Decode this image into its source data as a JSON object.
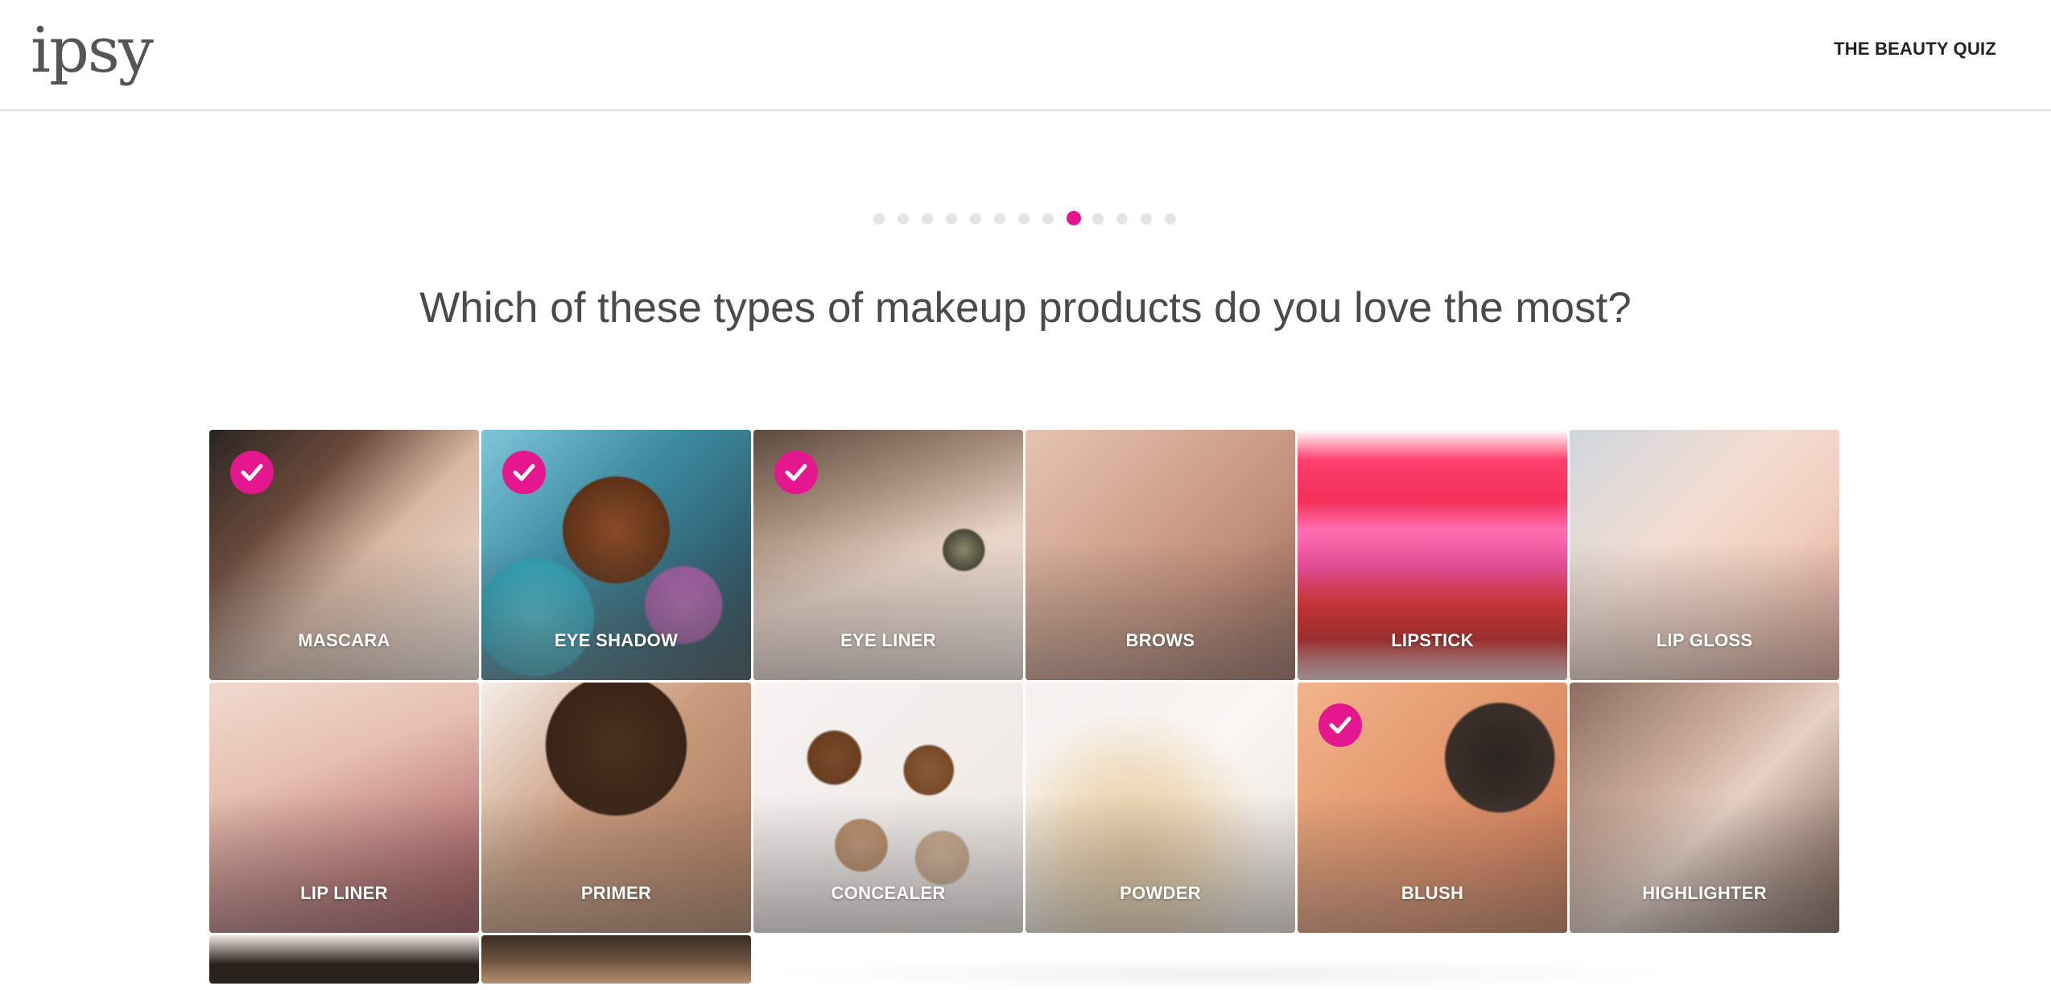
{
  "header": {
    "logo_text": "ipsy",
    "nav_link": "THE BEAUTY QUIZ"
  },
  "progress": {
    "total_steps": 13,
    "current_step": 9
  },
  "question": {
    "text": "Which of these types of makeup products do you love the most?"
  },
  "options": [
    {
      "label": "MASCARA",
      "selected": true
    },
    {
      "label": "EYE SHADOW",
      "selected": true
    },
    {
      "label": "EYE LINER",
      "selected": true
    },
    {
      "label": "BROWS",
      "selected": false
    },
    {
      "label": "LIPSTICK",
      "selected": false
    },
    {
      "label": "LIP GLOSS",
      "selected": false
    },
    {
      "label": "LIP LINER",
      "selected": false
    },
    {
      "label": "PRIMER",
      "selected": false
    },
    {
      "label": "CONCEALER",
      "selected": false
    },
    {
      "label": "POWDER",
      "selected": false
    },
    {
      "label": "BLUSH",
      "selected": true
    },
    {
      "label": "HIGHLIGHTER",
      "selected": false
    },
    {
      "label": "",
      "selected": false
    },
    {
      "label": "",
      "selected": false
    }
  ],
  "colors": {
    "accent": "#e4178e",
    "text": "#4a4a4a"
  }
}
